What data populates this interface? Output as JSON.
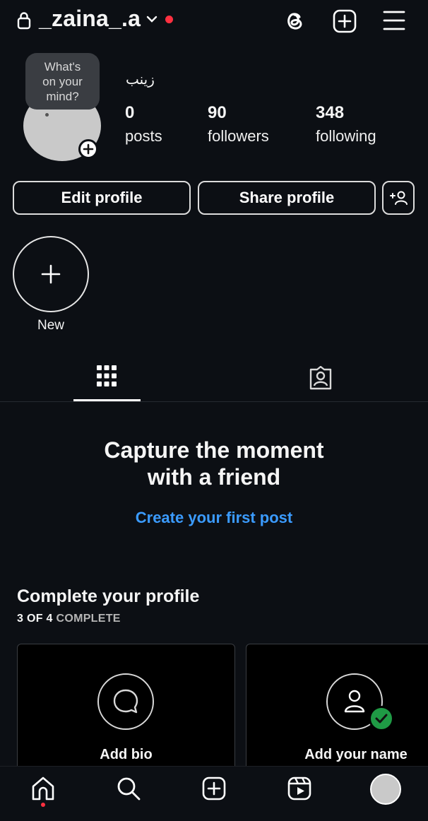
{
  "header": {
    "username": "_zaina_.a",
    "has_notification_dot": true
  },
  "profile": {
    "note_lines": [
      "What's",
      "on your",
      "mind?"
    ],
    "display_name": "زينب",
    "stats": {
      "posts_count": "0",
      "posts_label": "posts",
      "followers_count": "90",
      "followers_label": "followers",
      "following_count": "348",
      "following_label": "following"
    }
  },
  "actions": {
    "edit_label": "Edit profile",
    "share_label": "Share profile"
  },
  "highlights": {
    "new_label": "New"
  },
  "tabs": {
    "active": "grid"
  },
  "empty_state": {
    "title_line1": "Capture the moment",
    "title_line2": "with a friend",
    "link": "Create your first post"
  },
  "complete_profile": {
    "title": "Complete your profile",
    "progress_strong": "3 OF 4",
    "progress_rest": " COMPLETE",
    "cards": [
      {
        "label": "Add bio",
        "icon": "chat-bubble-icon",
        "done": false
      },
      {
        "label": "Add your name",
        "icon": "person-icon",
        "done": true
      }
    ]
  },
  "colors": {
    "background": "#0c0f14",
    "link": "#3b9bff",
    "notification": "#ff3040",
    "check_badge": "#1f9a45"
  },
  "bottom_nav": {
    "items": [
      "home-icon",
      "search-icon",
      "create-icon",
      "reels-icon",
      "profile-avatar"
    ]
  }
}
